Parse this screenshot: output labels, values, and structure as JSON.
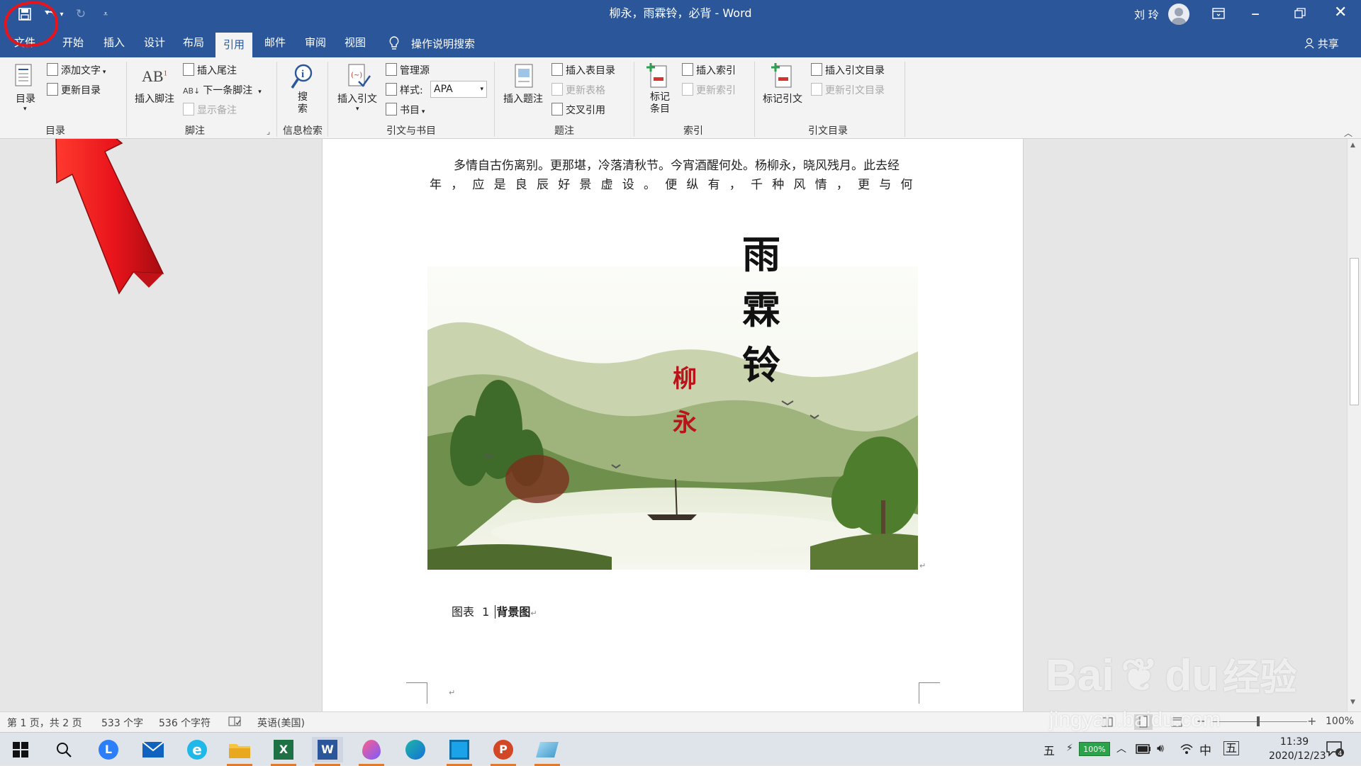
{
  "window": {
    "title": "柳永，雨霖铃，必背 - Word",
    "user": "刘 玲"
  },
  "tabs": [
    "文件",
    "开始",
    "插入",
    "设计",
    "布局",
    "引用",
    "邮件",
    "审阅",
    "视图"
  ],
  "active_tab": "引用",
  "tell_me": "操作说明搜索",
  "share": "共享",
  "ribbon": {
    "toc": {
      "label": "目录",
      "add_text": "添加文字",
      "update": "更新目录",
      "group": "目录"
    },
    "footnotes": {
      "insert_footnote": "插入脚注",
      "insert_endnote": "插入尾注",
      "next_footnote": "下一条脚注",
      "show_notes": "显示备注",
      "group": "脚注"
    },
    "research": {
      "search": "搜索",
      "group": "信息检索"
    },
    "citations": {
      "insert_citation": "插入引文",
      "manage_sources": "管理源",
      "style_label": "样式:",
      "style_value": "APA",
      "bibliography": "书目",
      "group": "引文与书目"
    },
    "captions": {
      "insert_caption": "插入题注",
      "insert_table_of_figures": "插入表目录",
      "update_table": "更新表格",
      "cross_reference": "交叉引用",
      "group": "题注"
    },
    "index": {
      "mark_entry": "标记条目",
      "insert_index": "插入索引",
      "update_index": "更新索引",
      "group": "索引"
    },
    "toa": {
      "mark_citation": "标记引文",
      "insert_toa": "插入引文目录",
      "update_toa": "更新引文目录",
      "group": "引文目录"
    }
  },
  "document": {
    "line1": "多情自古伤离别。更那堪，冷落清秋节。今宵酒醒何处。杨柳永，晓风残月。此去经",
    "line2": "年，应是良辰好景虚设。便纵有，千种风情，更与何人说。",
    "caption_label": "图表",
    "caption_number": "1",
    "caption_text": "背景图",
    "image": {
      "title_chars": [
        "雨",
        "霖",
        "铃"
      ],
      "author_chars": [
        "柳",
        "永"
      ]
    }
  },
  "status": {
    "page": "第 1 页，共 2 页",
    "words": "533 个字",
    "chars": "536 个字符",
    "language": "英语(美国)",
    "zoom": "100%"
  },
  "taskbar": {
    "time": "11:39",
    "date": "2020/12/23",
    "ime": "中",
    "ime_mode": "五",
    "battery": "100%"
  },
  "watermark": {
    "brand": "Bai",
    "brand2": "du",
    "cn": "经验",
    "url": "jingyan.baidu.com"
  },
  "colors": {
    "word_blue": "#2b579a",
    "annotation_red": "#e8141b"
  }
}
